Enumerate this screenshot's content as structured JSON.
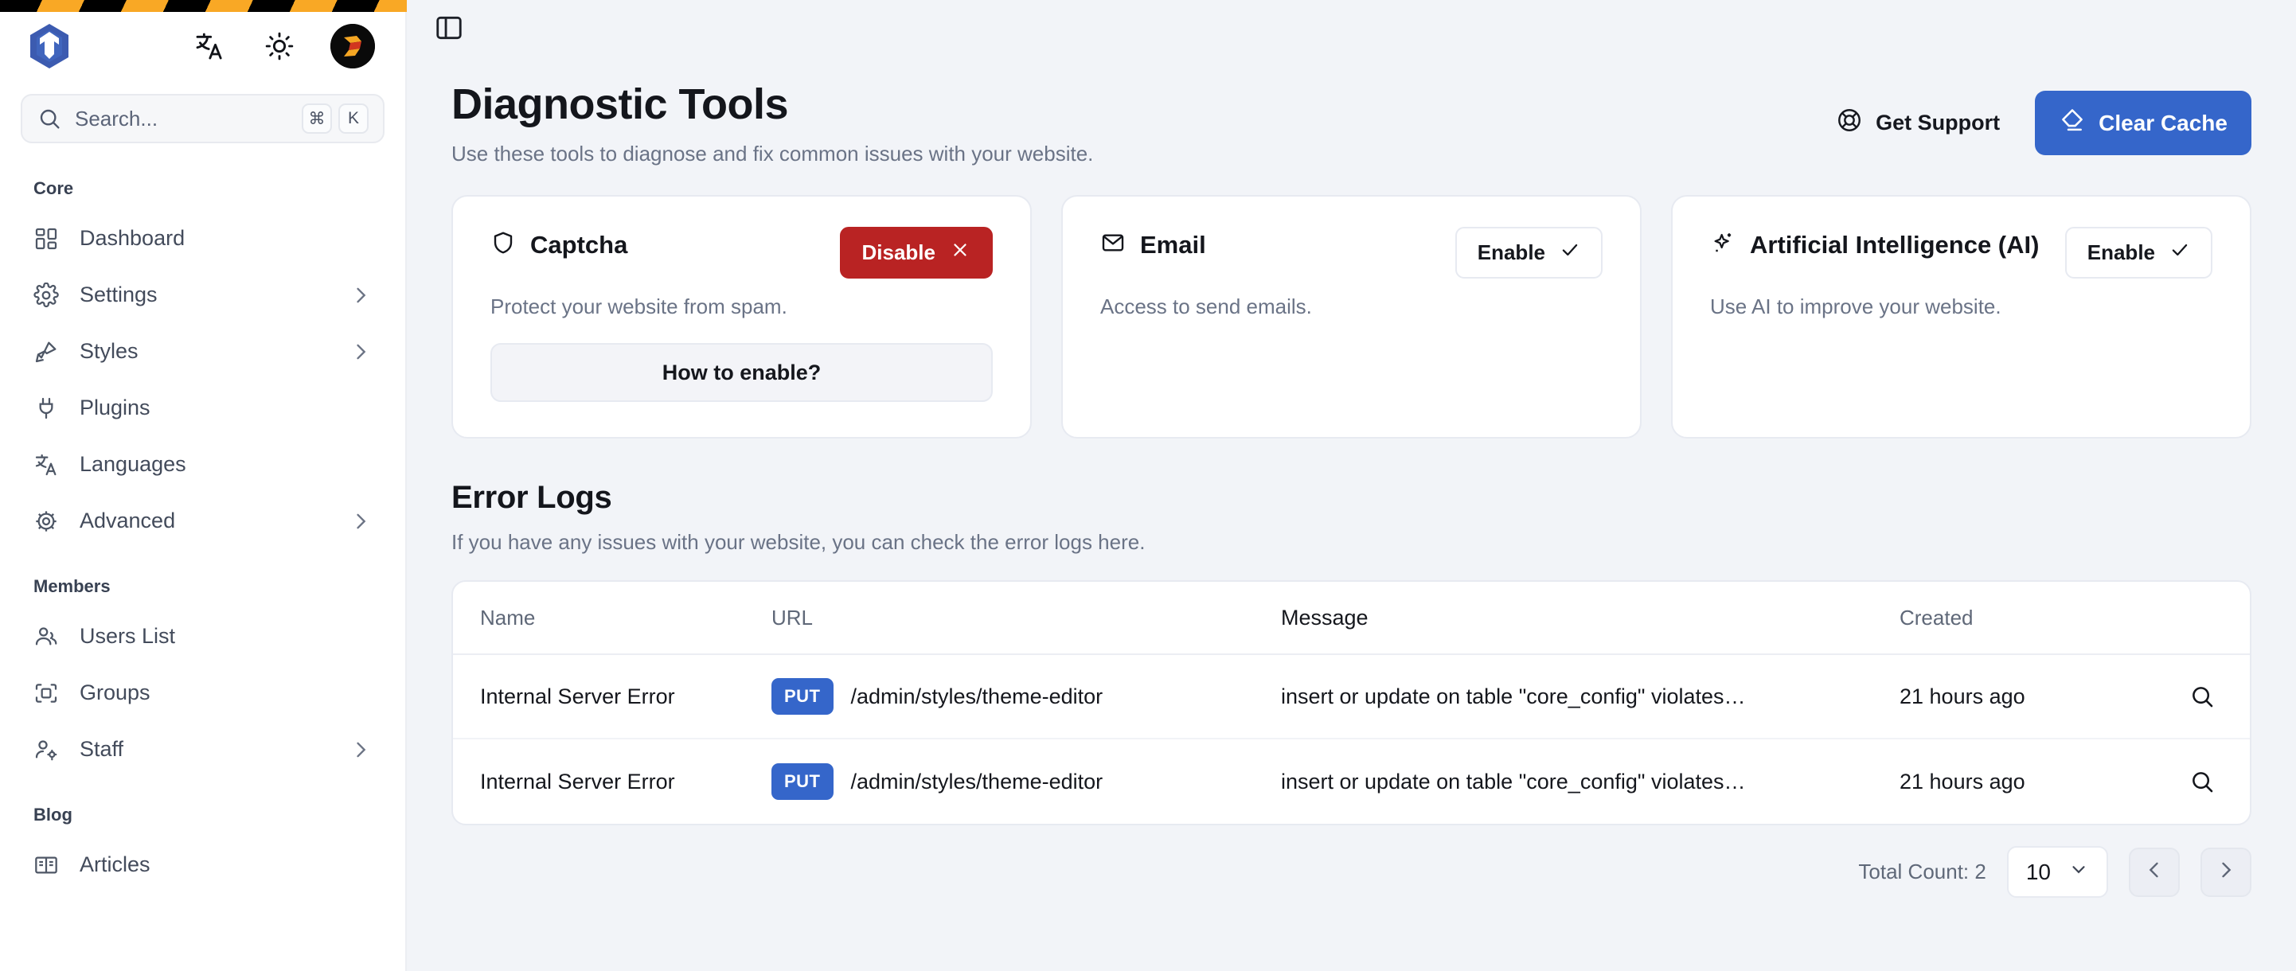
{
  "sidebar": {
    "logo_icon": "vvveb-logo",
    "top_icons": [
      {
        "name": "translate-icon",
        "label": "Translate"
      },
      {
        "name": "sun-icon",
        "label": "Theme"
      }
    ],
    "avatar_name": "user-avatar",
    "search": {
      "placeholder": "Search...",
      "shortcut_keys": [
        "⌘",
        "K"
      ]
    },
    "groups": [
      {
        "label": "Core",
        "items": [
          {
            "label": "Dashboard",
            "icon": "dashboard-icon",
            "chevron": false
          },
          {
            "label": "Settings",
            "icon": "gear-icon",
            "chevron": true
          },
          {
            "label": "Styles",
            "icon": "brush-icon",
            "chevron": true
          },
          {
            "label": "Plugins",
            "icon": "plug-icon",
            "chevron": false
          },
          {
            "label": "Languages",
            "icon": "translate-icon",
            "chevron": false
          },
          {
            "label": "Advanced",
            "icon": "cog-icon",
            "chevron": true
          }
        ]
      },
      {
        "label": "Members",
        "items": [
          {
            "label": "Users List",
            "icon": "users-icon",
            "chevron": false
          },
          {
            "label": "Groups",
            "icon": "groups-icon",
            "chevron": false
          },
          {
            "label": "Staff",
            "icon": "user-gear-icon",
            "chevron": true
          }
        ]
      },
      {
        "label": "Blog",
        "items": [
          {
            "label": "Articles",
            "icon": "book-icon",
            "chevron": false
          }
        ]
      }
    ]
  },
  "toolbar": {
    "panel_toggle_icon": "panel-left-icon"
  },
  "header": {
    "title": "Diagnostic Tools",
    "subtitle": "Use these tools to diagnose and fix common issues with your website.",
    "support_label": "Get Support",
    "support_icon": "lifebuoy-icon",
    "clear_cache_label": "Clear Cache",
    "clear_cache_icon": "eraser-icon",
    "primary_color": "#3566ca"
  },
  "cards": [
    {
      "title": "Captcha",
      "icon": "shield-icon",
      "description": "Protect your website from spam.",
      "state_label": "Disable",
      "state_icon": "x-icon",
      "state_style": "danger",
      "state_color": "#b92323",
      "extra_button": "How to enable?"
    },
    {
      "title": "Email",
      "icon": "envelope-icon",
      "description": "Access to send emails.",
      "state_label": "Enable",
      "state_icon": "check-icon",
      "state_style": "outline",
      "extra_button": null
    },
    {
      "title": "Artificial Intelligence (AI)",
      "icon": "sparkle-icon",
      "description": "Use AI to improve your website.",
      "state_label": "Enable",
      "state_icon": "check-icon",
      "state_style": "outline",
      "extra_button": null
    }
  ],
  "logs": {
    "title": "Error Logs",
    "subtitle": "If you have any issues with your website, you can check the error logs here.",
    "columns": [
      "Name",
      "URL",
      "Message",
      "Created"
    ],
    "rows": [
      {
        "name": "Internal Server Error",
        "method": "PUT",
        "url": "/admin/styles/theme-editor",
        "message": "insert or update on table \"core_config\" violates…",
        "created": "21 hours ago",
        "action_icon": "search-icon"
      },
      {
        "name": "Internal Server Error",
        "method": "PUT",
        "url": "/admin/styles/theme-editor",
        "message": "insert or update on table \"core_config\" violates…",
        "created": "21 hours ago",
        "action_icon": "search-icon"
      }
    ]
  },
  "pagination": {
    "total_label": "Total Count: 2",
    "page_size": "10",
    "prev_icon": "chevron-left-icon",
    "next_icon": "chevron-right-icon"
  }
}
